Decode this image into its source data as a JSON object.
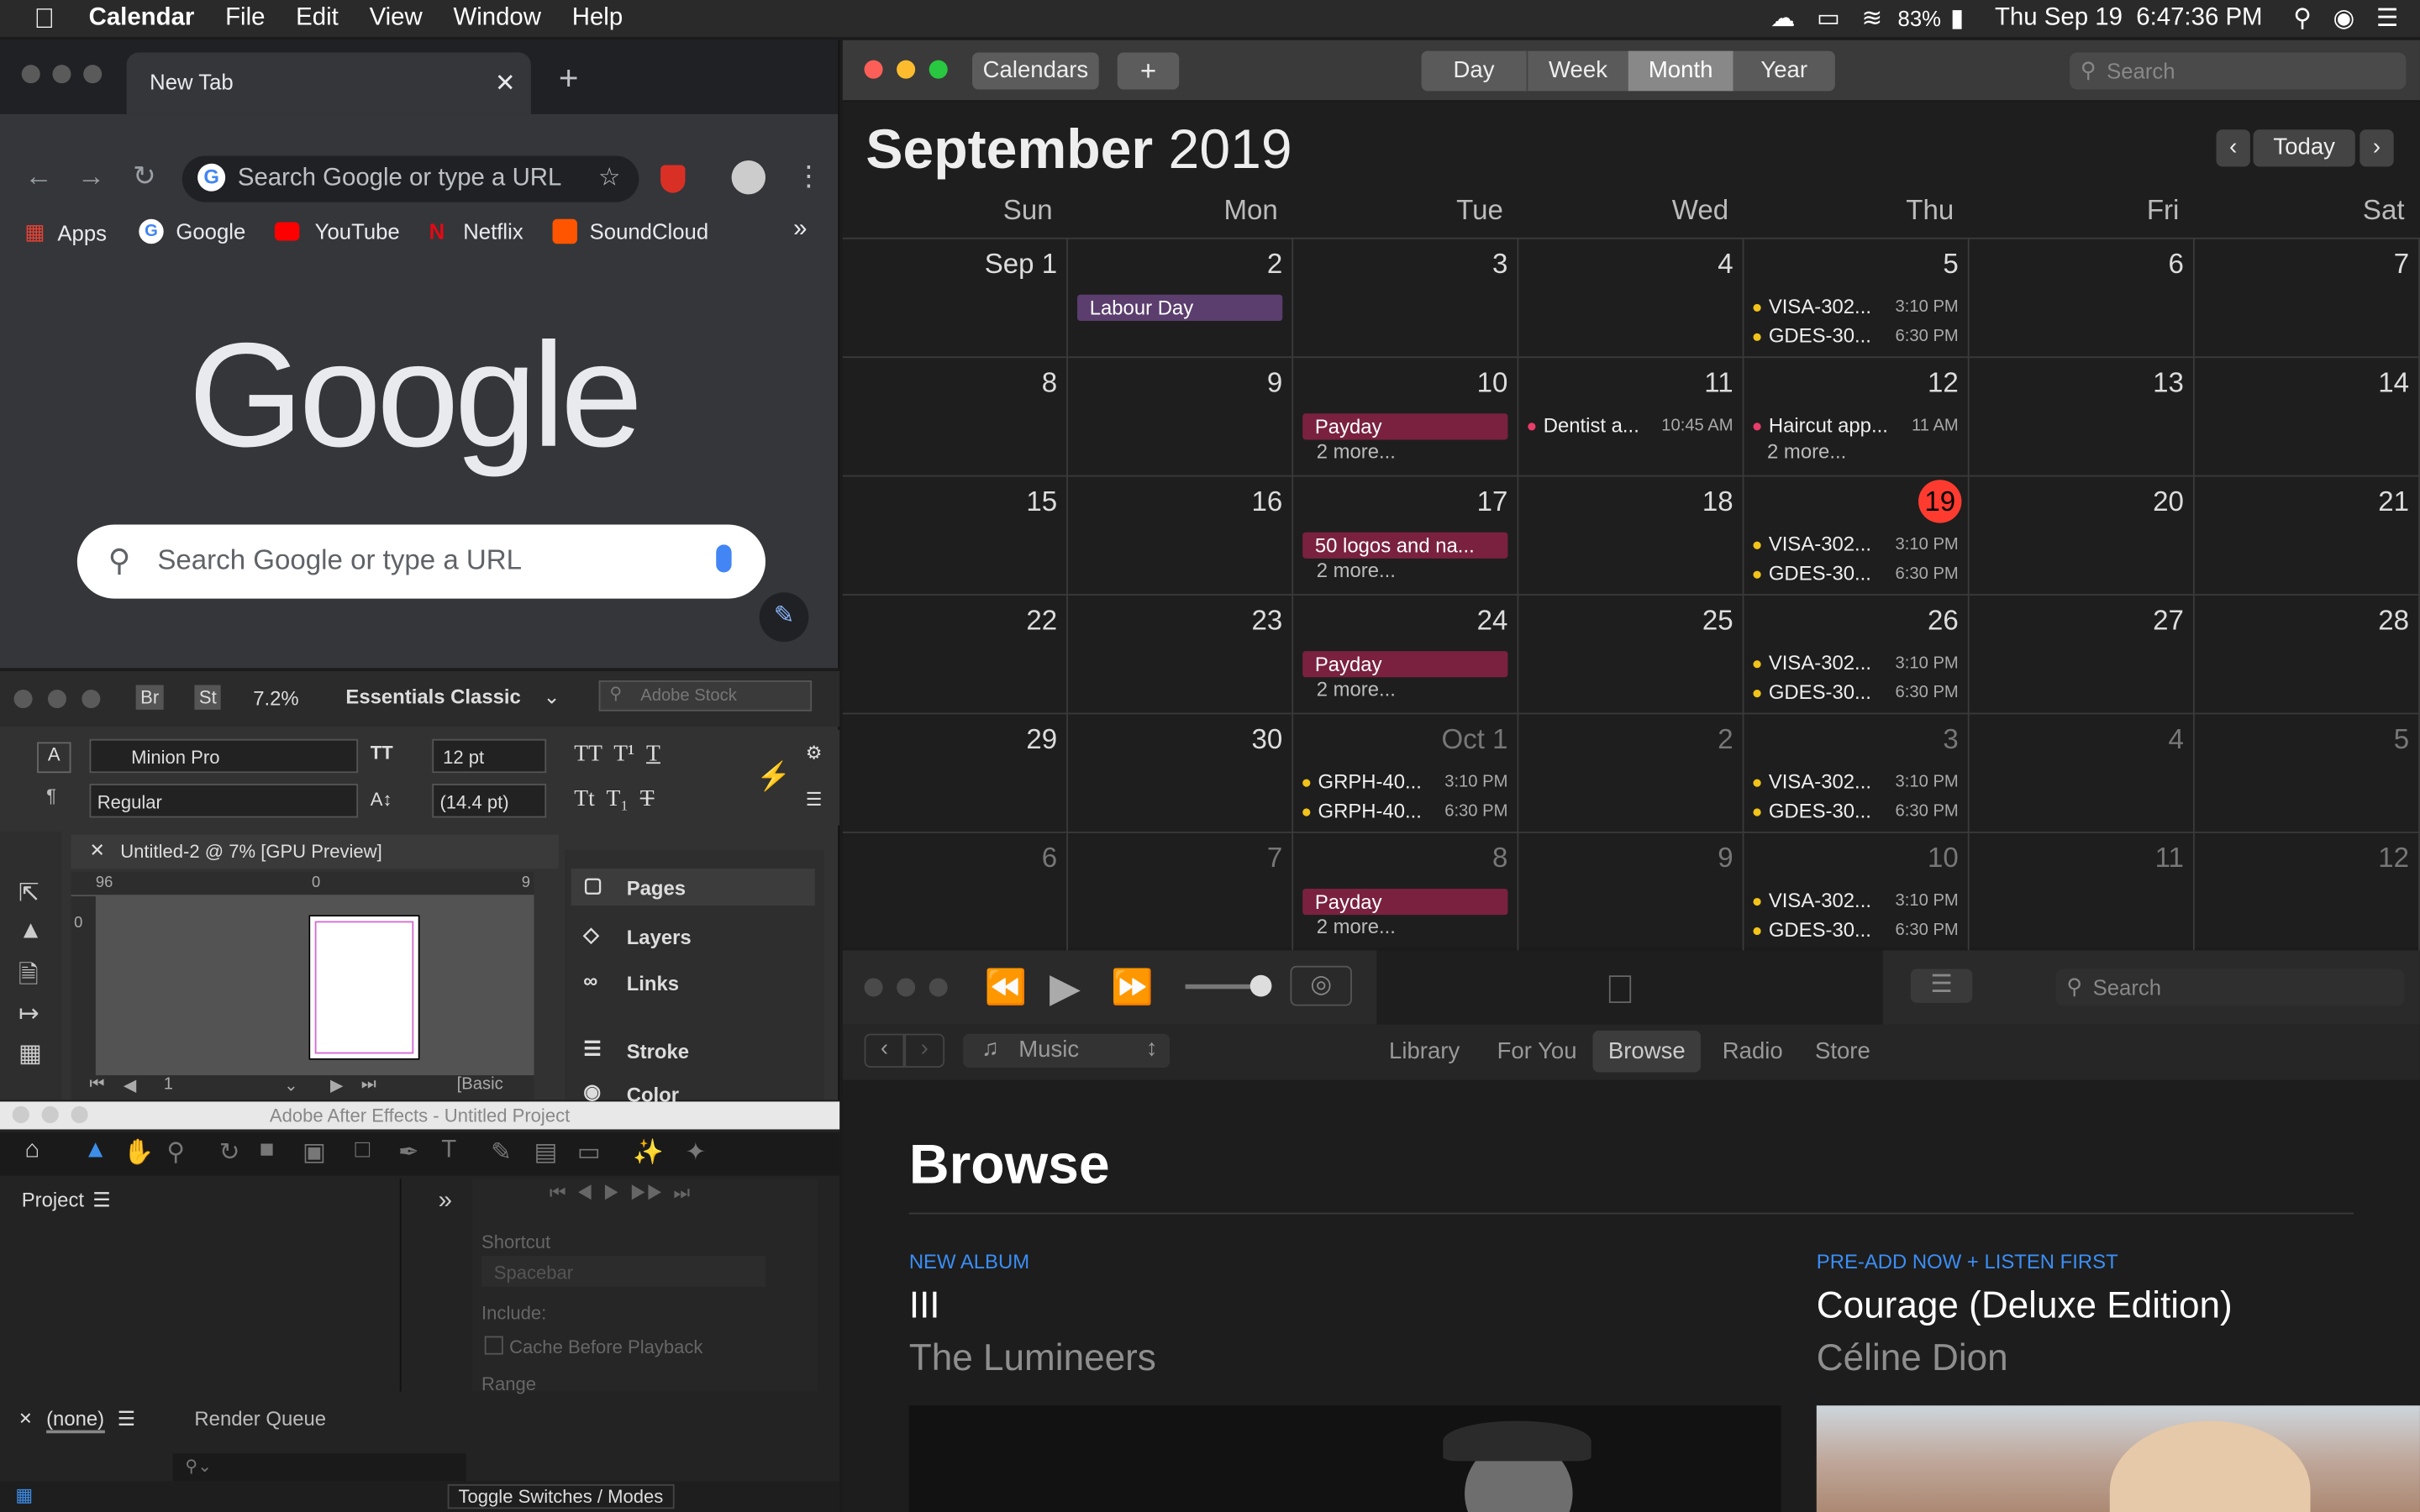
{
  "menubar": {
    "app": "Calendar",
    "items": [
      "File",
      "Edit",
      "View",
      "Window",
      "Help"
    ],
    "battery": "83%",
    "clock": "Thu Sep 19  6:47:36 PM"
  },
  "chrome": {
    "tab_title": "New Tab",
    "omnibox_placeholder": "Search Google or type a URL",
    "bookmarks": [
      "Apps",
      "Google",
      "YouTube",
      "Netflix",
      "SoundCloud"
    ],
    "logo": "Google",
    "search_placeholder": "Search Google or type a URL"
  },
  "indesign": {
    "zoom": "7.2%",
    "workspace": "Essentials Classic",
    "stock_search": "Adobe Stock",
    "font": "Minion Pro",
    "style": "Regular",
    "size": "12 pt",
    "leading": "(14.4 pt)",
    "doc_tab": "Untitled-2 @ 7% [GPU Preview]",
    "ruler": [
      "96",
      "0",
      "9"
    ],
    "vruler": "0",
    "page_num": "1",
    "basic": "[Basic",
    "panels": [
      "Pages",
      "Layers",
      "Links",
      "Stroke",
      "Color"
    ]
  },
  "ae": {
    "title": "Adobe After Effects - Untitled Project",
    "project": "Project",
    "shortcut_label": "Shortcut",
    "shortcut_value": "Spacebar",
    "include": "Include:",
    "cache": "Cache Before Playback",
    "range": "Range",
    "comp": "(none)",
    "render_queue": "Render Queue",
    "toggle": "Toggle Switches / Modes"
  },
  "calendar": {
    "calendars_btn": "Calendars",
    "add_btn": "+",
    "views": [
      "Day",
      "Week",
      "Month",
      "Year"
    ],
    "active_view": "Month",
    "search_placeholder": "Search",
    "month": "September",
    "year": "2019",
    "today_btn": "Today",
    "daynames": [
      "Sun",
      "Mon",
      "Tue",
      "Wed",
      "Thu",
      "Fri",
      "Sat"
    ],
    "weeks": [
      [
        {
          "n": "Sep 1"
        },
        {
          "n": "2",
          "events": [
            {
              "k": "bar",
              "text": "Labour Day",
              "color": "#5b3d6e"
            }
          ]
        },
        {
          "n": "3"
        },
        {
          "n": "4"
        },
        {
          "n": "5",
          "events": [
            {
              "k": "timed",
              "text": "VISA-302...",
              "time": "3:10 PM",
              "color": "#f2c31a"
            },
            {
              "k": "timed",
              "text": "GDES-30...",
              "time": "6:30 PM",
              "color": "#f2c31a"
            }
          ]
        },
        {
          "n": "6"
        },
        {
          "n": "7"
        }
      ],
      [
        {
          "n": "8"
        },
        {
          "n": "9"
        },
        {
          "n": "10",
          "events": [
            {
              "k": "bar",
              "text": "Payday",
              "color": "#7a2140"
            },
            {
              "k": "more",
              "text": "2 more..."
            }
          ]
        },
        {
          "n": "11",
          "events": [
            {
              "k": "timed",
              "text": "Dentist a...",
              "time": "10:45 AM",
              "color": "#e93d6a"
            }
          ]
        },
        {
          "n": "12",
          "events": [
            {
              "k": "timed",
              "text": "Haircut app...",
              "time": "11 AM",
              "color": "#e93d6a"
            },
            {
              "k": "more",
              "text": "2 more..."
            }
          ]
        },
        {
          "n": "13"
        },
        {
          "n": "14"
        }
      ],
      [
        {
          "n": "15"
        },
        {
          "n": "16"
        },
        {
          "n": "17",
          "events": [
            {
              "k": "bar",
              "text": "50 logos and na...",
              "color": "#7a2140"
            },
            {
              "k": "more",
              "text": "2 more..."
            }
          ]
        },
        {
          "n": "18"
        },
        {
          "n": "19",
          "today": true,
          "events": [
            {
              "k": "timed",
              "text": "VISA-302...",
              "time": "3:10 PM",
              "color": "#f2c31a"
            },
            {
              "k": "timed",
              "text": "GDES-30...",
              "time": "6:30 PM",
              "color": "#f2c31a"
            }
          ]
        },
        {
          "n": "20"
        },
        {
          "n": "21"
        }
      ],
      [
        {
          "n": "22"
        },
        {
          "n": "23"
        },
        {
          "n": "24",
          "events": [
            {
              "k": "bar",
              "text": "Payday",
              "color": "#7a2140"
            },
            {
              "k": "more",
              "text": "2 more..."
            }
          ]
        },
        {
          "n": "25"
        },
        {
          "n": "26",
          "events": [
            {
              "k": "timed",
              "text": "VISA-302...",
              "time": "3:10 PM",
              "color": "#f2c31a"
            },
            {
              "k": "timed",
              "text": "GDES-30...",
              "time": "6:30 PM",
              "color": "#f2c31a"
            }
          ]
        },
        {
          "n": "27"
        },
        {
          "n": "28"
        }
      ],
      [
        {
          "n": "29"
        },
        {
          "n": "30"
        },
        {
          "n": "Oct 1",
          "dim": true,
          "events": [
            {
              "k": "timed",
              "text": "GRPH-40...",
              "time": "3:10 PM",
              "color": "#f2c31a"
            },
            {
              "k": "timed",
              "text": "GRPH-40...",
              "time": "6:30 PM",
              "color": "#f2c31a"
            }
          ]
        },
        {
          "n": "2",
          "dim": true
        },
        {
          "n": "3",
          "dim": true,
          "events": [
            {
              "k": "timed",
              "text": "VISA-302...",
              "time": "3:10 PM",
              "color": "#f2c31a"
            },
            {
              "k": "timed",
              "text": "GDES-30...",
              "time": "6:30 PM",
              "color": "#f2c31a"
            }
          ]
        },
        {
          "n": "4",
          "dim": true
        },
        {
          "n": "5",
          "dim": true
        }
      ],
      [
        {
          "n": "6",
          "dim": true
        },
        {
          "n": "7",
          "dim": true
        },
        {
          "n": "8",
          "dim": true,
          "events": [
            {
              "k": "bar",
              "text": "Payday",
              "color": "#7a2140"
            },
            {
              "k": "more",
              "text": "2 more..."
            }
          ]
        },
        {
          "n": "9",
          "dim": true
        },
        {
          "n": "10",
          "dim": true,
          "events": [
            {
              "k": "timed",
              "text": "VISA-302...",
              "time": "3:10 PM",
              "color": "#f2c31a"
            },
            {
              "k": "timed",
              "text": "GDES-30...",
              "time": "6:30 PM",
              "color": "#f2c31a"
            }
          ]
        },
        {
          "n": "11",
          "dim": true
        },
        {
          "n": "12",
          "dim": true
        }
      ]
    ]
  },
  "music": {
    "search_placeholder": "Search",
    "source": "Music",
    "nav": [
      "Library",
      "For You",
      "Browse",
      "Radio",
      "Store"
    ],
    "active_nav": "Browse",
    "heading": "Browse",
    "albums": [
      {
        "tag": "NEW ALBUM",
        "title": "III",
        "artist": "The Lumineers"
      },
      {
        "tag": "PRE-ADD NOW + LISTEN FIRST",
        "title": "Courage (Deluxe Edition)",
        "artist": "Céline Dion"
      }
    ]
  }
}
